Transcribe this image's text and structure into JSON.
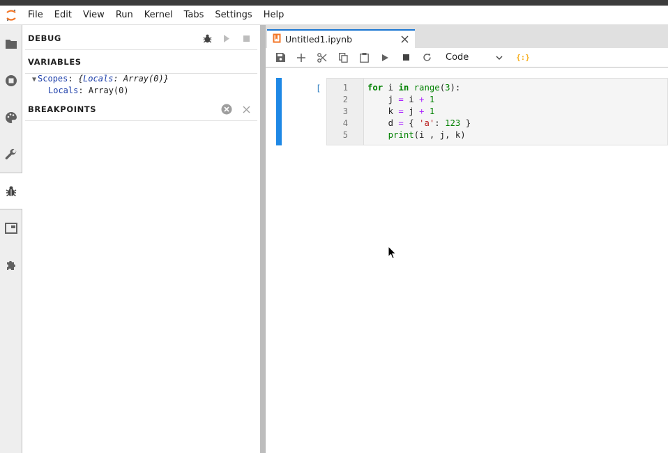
{
  "menubar": {
    "items": [
      "File",
      "Edit",
      "View",
      "Run",
      "Kernel",
      "Tabs",
      "Settings",
      "Help"
    ]
  },
  "leftbar": {
    "icons": [
      "folder-icon",
      "running-icon",
      "palette-icon",
      "wrench-icon",
      "bug-icon",
      "tabs-icon",
      "extension-icon"
    ],
    "active": "bug-icon"
  },
  "debugger": {
    "title": "DEBUG",
    "variables_title": "VARIABLES",
    "scopes_key": "Scopes",
    "scopes_value": "{Locals: Array(0)}",
    "scopes_value_key": "Locals",
    "scopes_value_rest": "Array(0)",
    "locals_key": "Locals",
    "locals_value": "Array(0)",
    "breakpoints_title": "BREAKPOINTS"
  },
  "notebook": {
    "tab_label": "Untitled1.ipynb",
    "cell_type": "Code",
    "kernel_badge": "{:}",
    "prompt": "[ ]:",
    "line_numbers": [
      "1",
      "2",
      "3",
      "4",
      "5"
    ],
    "code_lines": [
      "for i in range(3):",
      "    j = i + 1",
      "    k = j + 1",
      "    d = { 'a': 123 }",
      "    print(i , j, k)"
    ]
  },
  "colors": {
    "accent": "#1976d2",
    "cell_active_bar": "#1e88e5",
    "kernel_badge": "#f7b32b"
  }
}
